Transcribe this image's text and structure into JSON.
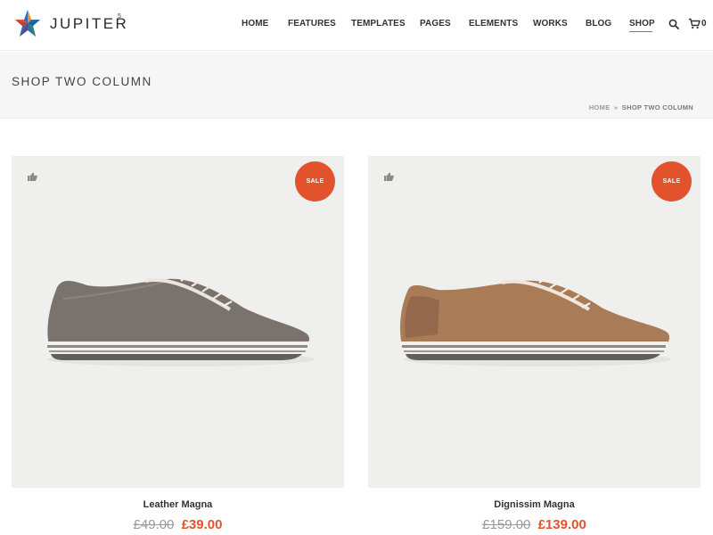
{
  "header": {
    "brand": "JUPITER",
    "brand_sup": "5",
    "nav": [
      {
        "label": "HOME"
      },
      {
        "label": "FEATURES"
      },
      {
        "label": "TEMPLATES"
      },
      {
        "label": "PAGES"
      },
      {
        "label": "ELEMENTS"
      },
      {
        "label": "WORKS"
      },
      {
        "label": "BLOG"
      },
      {
        "label": "SHOP",
        "active": true
      }
    ],
    "cart_count": "0",
    "accent_color": "#d9534f"
  },
  "page": {
    "title": "SHOP TWO COLUMN",
    "breadcrumb": {
      "home": "HOME",
      "separator": "»",
      "current": "SHOP TWO COLUMN"
    }
  },
  "products": [
    {
      "name": "Leather Magna",
      "badge": "SALE",
      "price_old": "£49.00",
      "price_new": "£39.00",
      "shoe_color": "#7a726c"
    },
    {
      "name": "Dignissim Magna",
      "badge": "SALE",
      "price_old": "£159.00",
      "price_new": "£139.00",
      "shoe_color": "#a97b57"
    }
  ],
  "colors": {
    "sale": "#e2532d",
    "image_bg": "#efefed",
    "title_band_bg": "#f6f6f6"
  },
  "icons": [
    "star-logo-icon",
    "search-icon",
    "cart-icon",
    "thumbs-up-icon"
  ]
}
